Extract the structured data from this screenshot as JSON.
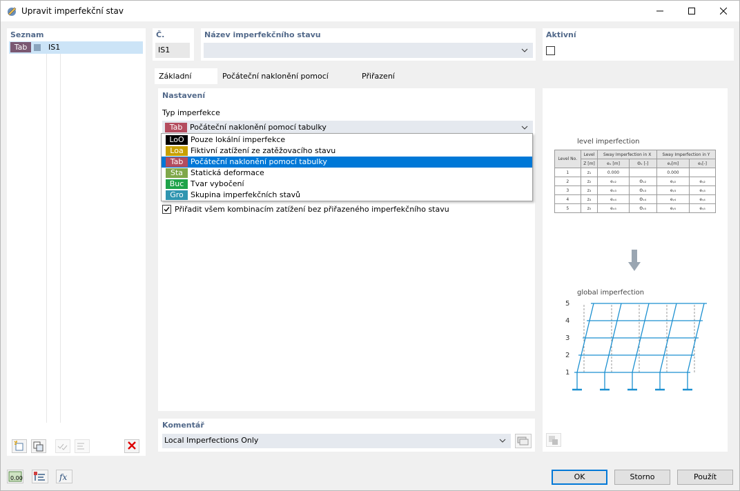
{
  "window": {
    "title": "Upravit imperfekční stav"
  },
  "list": {
    "header": "Seznam",
    "items": [
      {
        "tag": "Tab",
        "name": "IS1"
      }
    ]
  },
  "number": {
    "header": "Č.",
    "value": "IS1"
  },
  "name": {
    "header": "Název imperfekčního stavu",
    "value": ""
  },
  "active": {
    "header": "Aktivní",
    "checked": false
  },
  "tabs": [
    "Základní údaje",
    "Počáteční naklonění pomocí tabulky",
    "Přiřazení"
  ],
  "settings": {
    "header": "Nastavení",
    "type_label": "Typ imperfekce",
    "selected": {
      "tag": "Tab",
      "label": "Počáteční naklonění pomocí tabulky"
    },
    "options": [
      {
        "tag": "LoO",
        "label": "Pouze lokální imperfekce",
        "color": "#000000"
      },
      {
        "tag": "Loa",
        "label": "Fiktivní zatížení ze zatěžovacího stavu",
        "color": "#c8a000"
      },
      {
        "tag": "Tab",
        "label": "Počáteční naklonění pomocí tabulky",
        "color": "#b44c5e"
      },
      {
        "tag": "Sta",
        "label": "Statická deformace",
        "color": "#7fa84a"
      },
      {
        "tag": "Buc",
        "label": "Tvar vybočení",
        "color": "#1fa34a"
      },
      {
        "tag": "Gro",
        "label": "Skupina imperfekčních stavů",
        "color": "#2f95b0"
      }
    ],
    "assign_all_label": "Přiřadit všem kombinacím zatížení bez přiřazeného imperfekčního stavu",
    "assign_all_checked": true
  },
  "preview": {
    "level_title": "level imperfection",
    "global_title": "global imperfection",
    "table_headers": {
      "level_no": "Level No.",
      "level": "Level",
      "sway_x": "Sway Imperfection in X",
      "sway_y": "Sway Imperfection in Y",
      "z": "Z [m]",
      "ex": "eₓ [m]",
      "thx": "Θₓ [-]",
      "ey": "eᵧ[m]",
      "thy": "eᵧ[-]"
    },
    "rows": [
      [
        "1",
        "z₁",
        "0.000",
        "",
        "0.000",
        ""
      ],
      [
        "2",
        "z₂",
        "eₓ₂",
        "Θₓ₂",
        "eᵧ₂",
        "eᵧ₂"
      ],
      [
        "3",
        "z₃",
        "eₓ₃",
        "Θₓ₃",
        "eᵧ₃",
        "eᵧ₃"
      ],
      [
        "4",
        "z₄",
        "eₓ₄",
        "Θₓ₄",
        "eᵧ₄",
        "eᵧ₄"
      ],
      [
        "5",
        "z₅",
        "eₓ₅",
        "Θₓ₅",
        "eᵧ₅",
        "eᵧ₅"
      ]
    ],
    "levels": [
      "1",
      "2",
      "3",
      "4",
      "5"
    ]
  },
  "comment": {
    "header": "Komentář",
    "value": "Local Imperfections Only"
  },
  "buttons": {
    "ok": "OK",
    "cancel": "Storno",
    "apply": "Použít"
  },
  "accent": "#0078d7"
}
